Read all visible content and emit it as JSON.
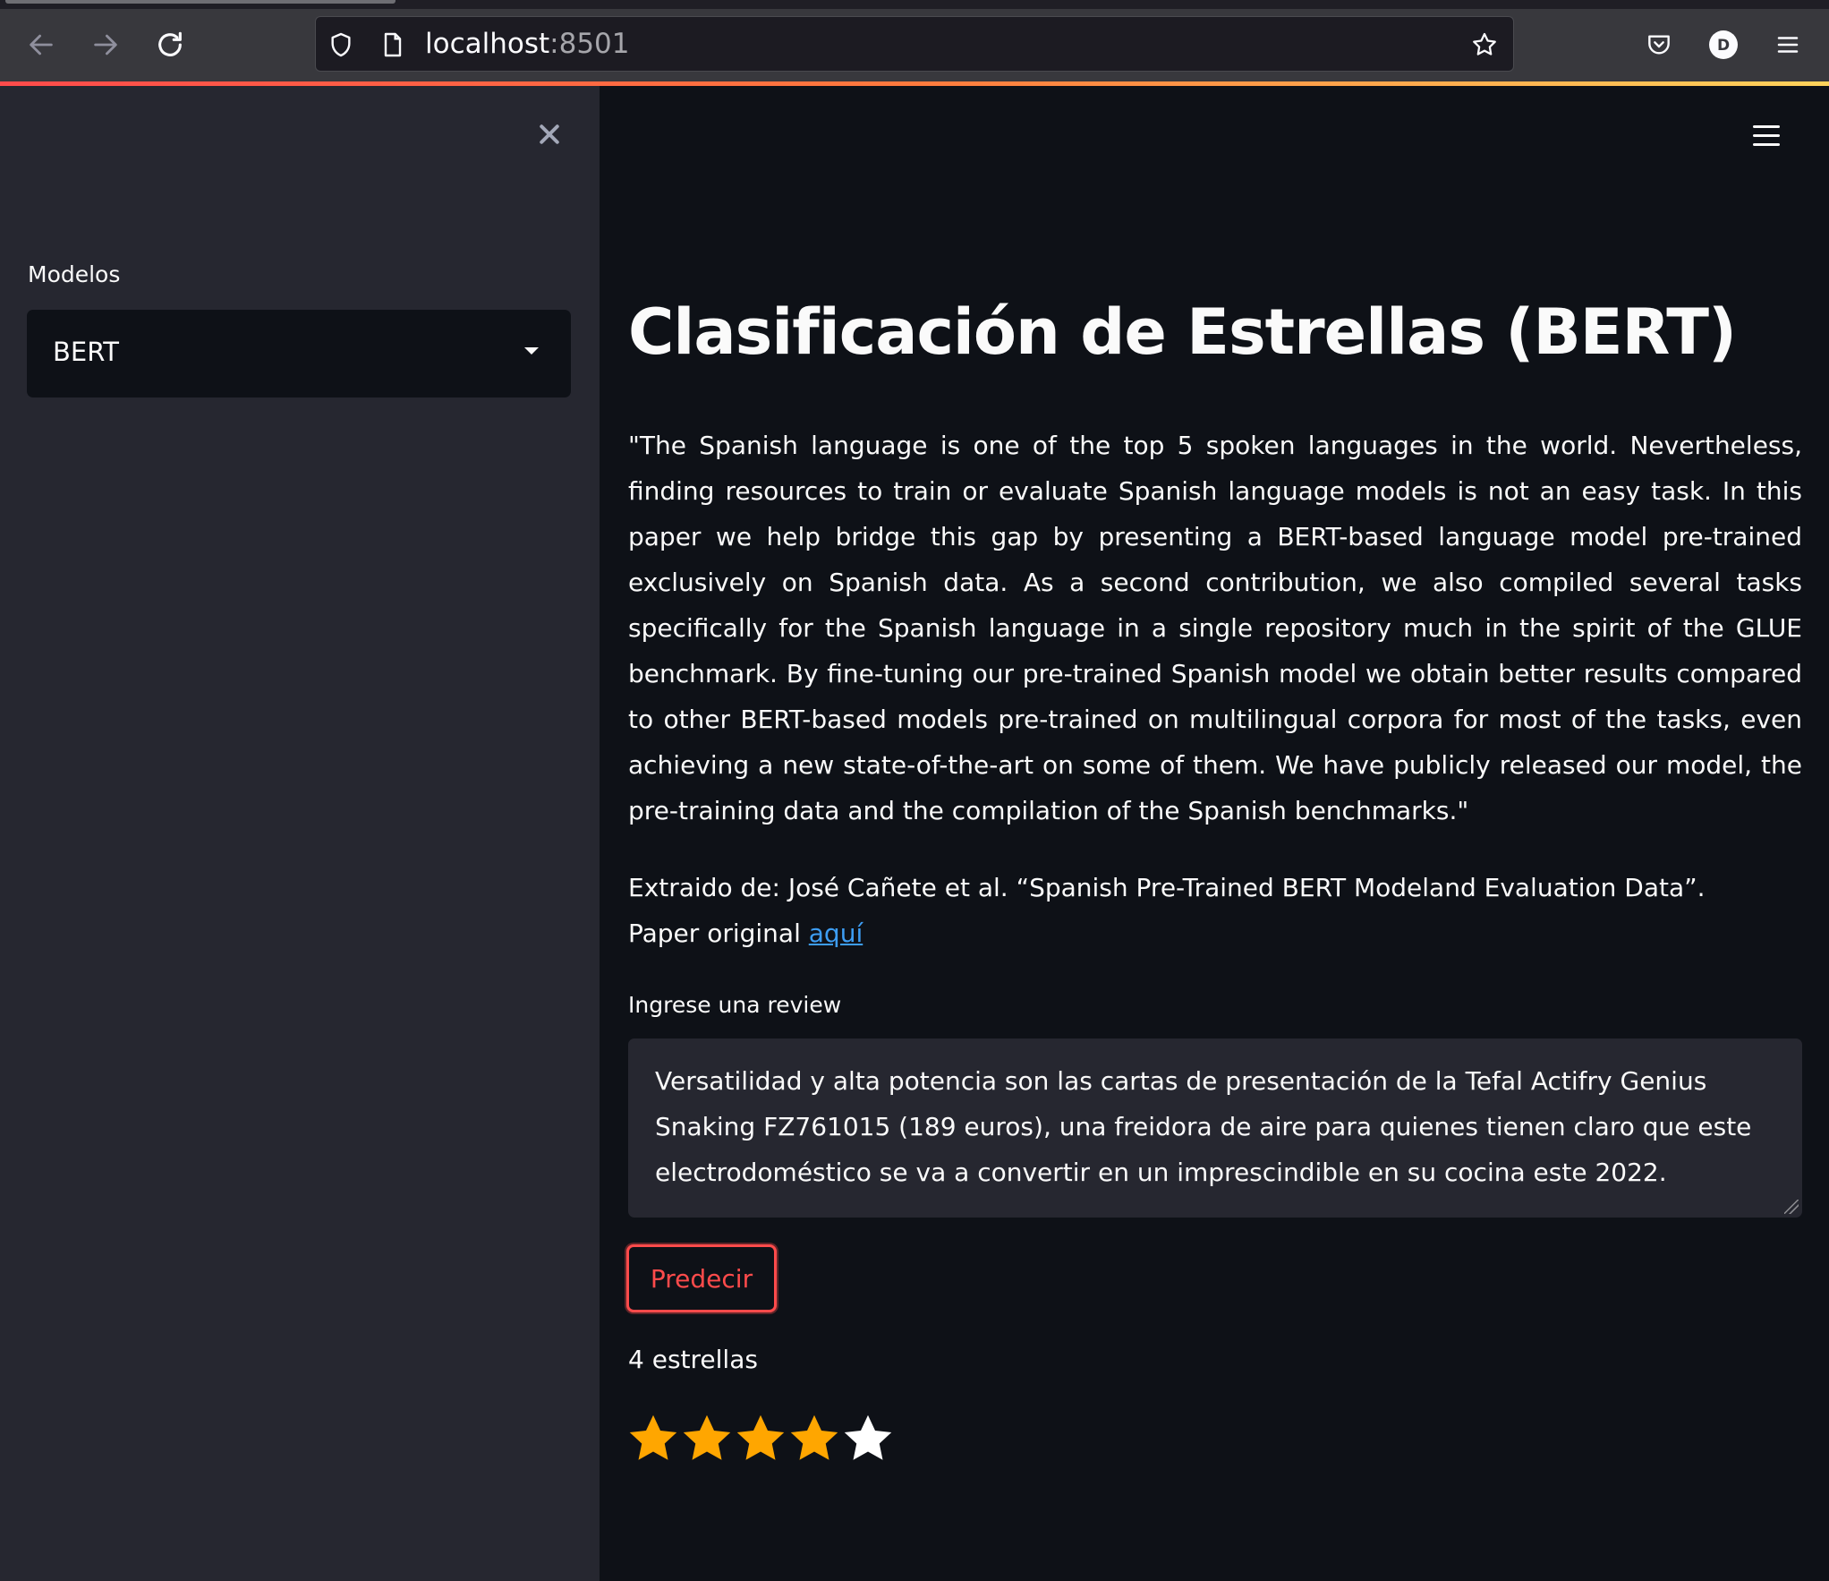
{
  "browser": {
    "url_host": "localhost",
    "url_port": ":8501",
    "profile_initial": "D"
  },
  "sidebar": {
    "select_label": "Modelos",
    "selected_model": "BERT"
  },
  "main": {
    "title": "Clasificación de Estrellas (BERT)",
    "abstract": "\"The Spanish language is one of the top 5 spoken languages in the world. Nevertheless, finding resources to train or evaluate Spanish language models is not an easy task. In this paper we help bridge this gap by presenting a BERT-based language model pre-trained exclusively on Spanish data. As a second contribution, we also compiled several tasks specifically for the Spanish language in a single repository much in the spirit of the GLUE benchmark. By fine-tuning our pre-trained Spanish model we obtain better results compared to other BERT-based models pre-trained on multilingual corpora for most of the tasks, even achieving a new state-of-the-art on some of them. We have publicly released our model, the pre-training data and the compilation of the Spanish benchmarks.\"",
    "citation": "Extraido de: José Cañete et al. “Spanish Pre-Trained BERT Modeland Evaluation Data”.",
    "paper_prefix": "Paper original ",
    "paper_link": "aquí",
    "review_label": "Ingrese una review",
    "review_text": "Versatilidad y alta potencia son las cartas de presentación de la Tefal Actifry Genius Snaking FZ761015 (189 euros), una freidora de aire para quienes tienen claro que este electrodoméstico se va a convertir en un imprescindible en su cocina este 2022.",
    "predict_button": "Predecir",
    "result_text": "4 estrellas",
    "rating": {
      "filled": 4,
      "total": 5,
      "filled_color": "#ffa600",
      "empty_color": "#ffffff"
    }
  },
  "colors": {
    "accent": "#ff4b4b",
    "link": "#3d9df3",
    "background": "#0e1117",
    "sidebar": "#262730"
  }
}
